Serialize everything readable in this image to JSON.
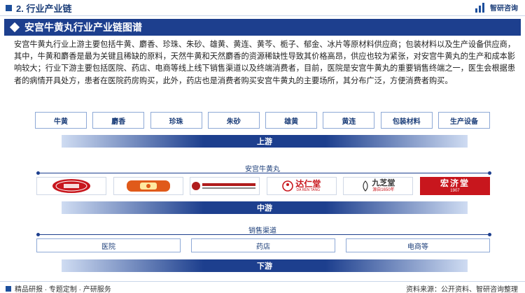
{
  "header": {
    "section": "2. 行业产业链",
    "brand": "智研咨询"
  },
  "title": "安宫牛黄丸行业产业链图谱",
  "paragraph": "安宫牛黄丸行业上游主要包括牛黄、麝香、珍珠、朱砂、雄黄、黄连、黄芩、栀子、郁金、冰片等原材料供应商；包装材料以及生产设备供应商，其中，牛黄和麝香是最为关键且稀缺的原料，天然牛黄和天然麝香的资源稀缺性导致其价格高昂，供应也较为紧张，对安宫牛黄丸的生产和成本影响较大；行业下游主要包括医院、药店、电商等线上线下销售渠道以及终端消费者，目前，医院是安宫牛黄丸的重要销售终端之一，医生会根据患者的病情开具处方，患者在医院药房购买，此外，药店也是消费者购买安宫牛黄丸的主要场所，其分布广泛，方便消费者购买。",
  "upstream": {
    "items": [
      "牛黄",
      "麝香",
      "珍珠",
      "朱砂",
      "雄黄",
      "黄连",
      "包装材料",
      "生产设备"
    ],
    "band": "上游"
  },
  "midstream": {
    "label": "安宫牛黄丸",
    "logos": [
      {
        "text": "",
        "bg": "#c8161d",
        "fg": "#ffffff"
      },
      {
        "text": "",
        "bg": "#e05a1a",
        "fg": "#ffe9a0"
      },
      {
        "text": "",
        "bg": "#ffffff",
        "fg": "#b01c1c"
      },
      {
        "text": "达仁堂",
        "sub": "DA REN TANG",
        "bg": "#ffffff",
        "fg": "#c8161d"
      },
      {
        "text": "九芝堂",
        "sub": "源自1650年",
        "bg": "#ffffff",
        "fg": "#333333"
      },
      {
        "text": "宏济堂",
        "sub": "1907",
        "bg": "#c8161d",
        "fg": "#ffffff"
      }
    ],
    "band": "中游"
  },
  "downstream": {
    "label": "销售渠道",
    "items": [
      "医院",
      "药店",
      "电商等"
    ],
    "band": "下游"
  },
  "footer": {
    "left": "精品研报 · 专题定制 · 产研服务",
    "right": "资料来源：公开资料、智研咨询整理"
  },
  "colors": {
    "primary": "#1d3f8e",
    "accent": "#1d4f9c",
    "border": "#8ea9d6"
  }
}
